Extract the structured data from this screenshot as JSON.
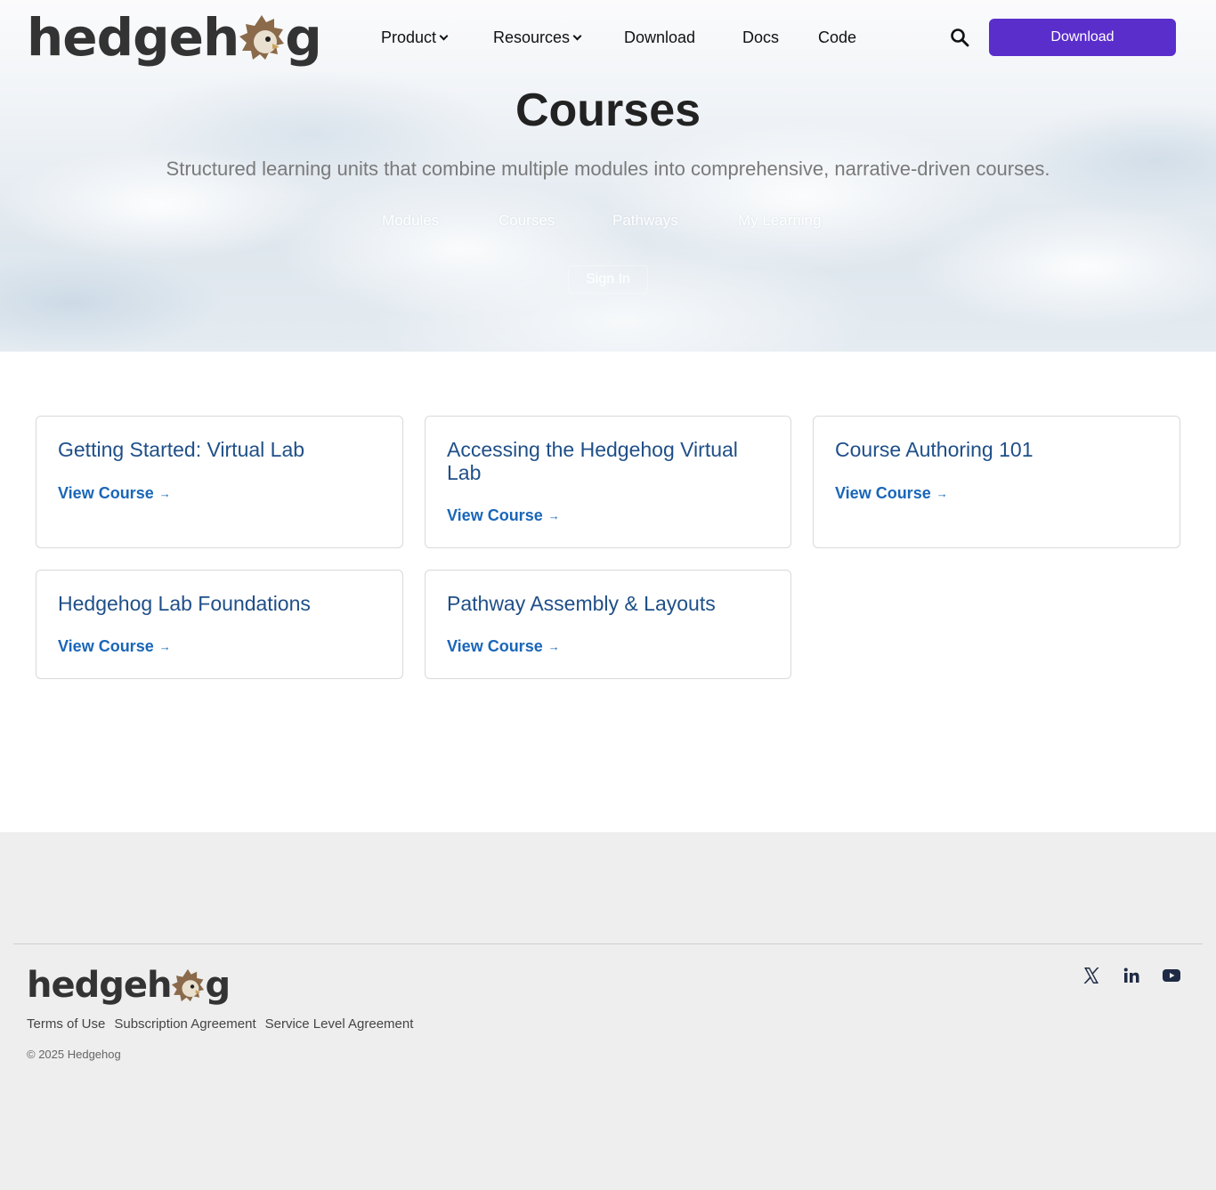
{
  "brand": {
    "name_part1": "hedgeh",
    "name_part2": "g"
  },
  "nav": {
    "items": [
      {
        "label": "Product",
        "has_dropdown": true
      },
      {
        "label": "Resources",
        "has_dropdown": true
      },
      {
        "label": "Download",
        "has_dropdown": false
      },
      {
        "label": "Docs",
        "has_dropdown": false
      },
      {
        "label": "Code",
        "has_dropdown": false
      }
    ],
    "search_icon": "search-icon",
    "cta_label": "Download"
  },
  "hero": {
    "title": "Courses",
    "subtitle": "Structured learning units that combine multiple modules into comprehensive, narrative-driven courses.",
    "tabs": [
      "Modules",
      "Courses",
      "Pathways",
      "My Learning"
    ],
    "signin_label": "Sign In"
  },
  "courses": [
    {
      "title": "Getting Started: Virtual Lab",
      "link": "View Course"
    },
    {
      "title": "Accessing the Hedgehog Virtual Lab",
      "link": "View Course"
    },
    {
      "title": "Course Authoring 101",
      "link": "View Course"
    },
    {
      "title": "Hedgehog Lab Foundations",
      "link": "View Course"
    },
    {
      "title": "Pathway Assembly & Layouts",
      "link": "View Course"
    }
  ],
  "footer": {
    "links": [
      "Terms of Use",
      "Subscription Agreement",
      "Service Level Agreement"
    ],
    "copyright": "© 2025 Hedgehog",
    "social": [
      "x-icon",
      "linkedin-icon",
      "youtube-icon"
    ]
  },
  "colors": {
    "accent": "#5a2ecb",
    "card_title": "#1f4f88",
    "link": "#1a66b8",
    "logo_text": "#333333",
    "logo_brown": "#8a6a4a"
  }
}
